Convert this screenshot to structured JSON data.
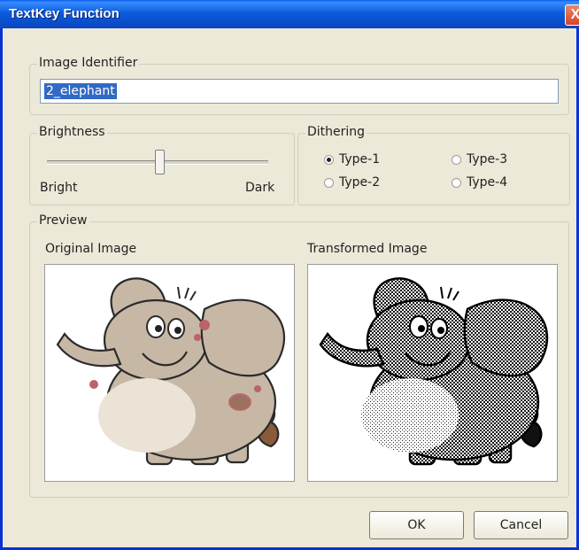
{
  "window": {
    "title": "TextKey Function",
    "close_label": "X"
  },
  "identifier": {
    "legend": "Image Identifier",
    "value": "2_elephant"
  },
  "brightness": {
    "legend": "Brightness",
    "min_label": "Bright",
    "max_label": "Dark",
    "level": 0.5
  },
  "dithering": {
    "legend": "Dithering",
    "options": [
      "Type-1",
      "Type-3",
      "Type-2",
      "Type-4"
    ],
    "selected": "Type-1"
  },
  "preview": {
    "legend": "Preview",
    "original_label": "Original Image",
    "transformed_label": "Transformed Image"
  },
  "buttons": {
    "ok": "OK",
    "cancel": "Cancel"
  },
  "colors": {
    "title_bar": "#0b5cdc",
    "dialog_bg": "#ece9d8",
    "selection": "#316ac5"
  }
}
